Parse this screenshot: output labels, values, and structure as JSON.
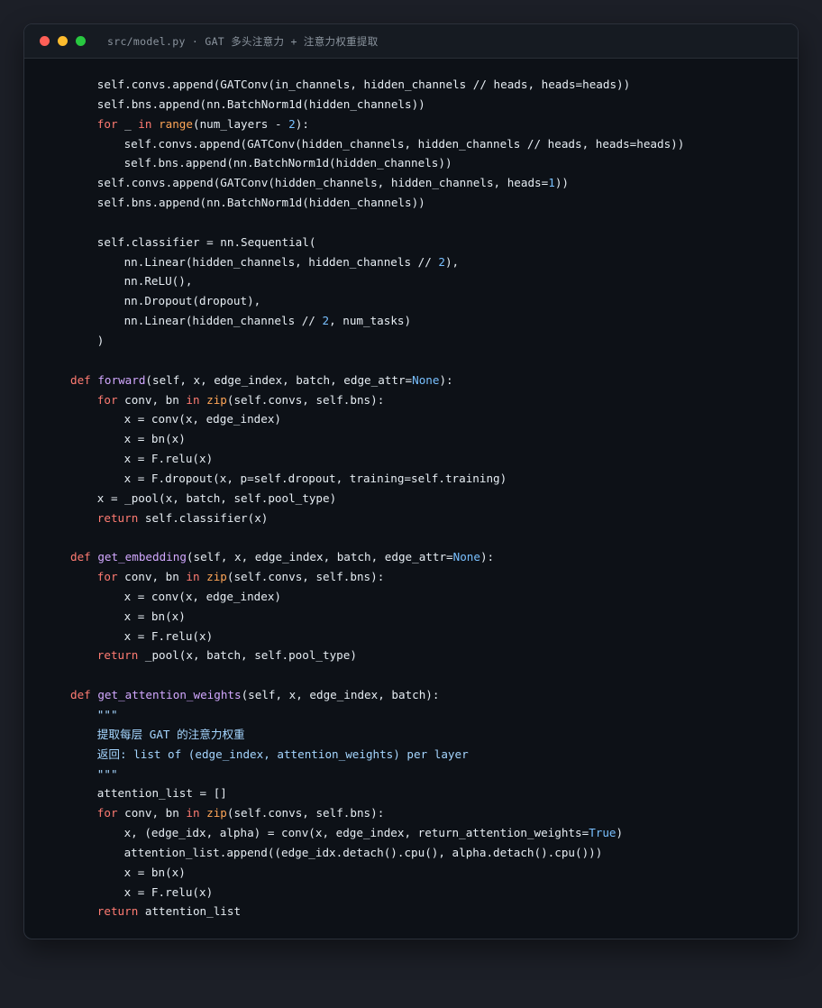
{
  "window": {
    "title": "src/model.py · GAT 多头注意力 + 注意力权重提取"
  },
  "colors": {
    "page_background": "#1c1f27",
    "editor_background": "#0d1117",
    "keyword": "#ff7b72",
    "function_name": "#d2a8ff",
    "builtin": "#ffa657",
    "number": "#79c0ff",
    "docstring": "#a5d6ff",
    "text": "#e6edf3"
  },
  "code_lines": [
    {
      "indent": 1,
      "tokens": [
        {
          "t": "self.convs.append(GATConv(in_channels, hidden_channels // heads, heads=heads))",
          "c": "plain"
        }
      ]
    },
    {
      "indent": 1,
      "tokens": [
        {
          "t": "self.bns.append(nn.BatchNorm1d(hidden_channels))",
          "c": "plain"
        }
      ]
    },
    {
      "indent": 1,
      "tokens": [
        {
          "t": "for",
          "c": "kw"
        },
        {
          "t": " _ ",
          "c": "plain"
        },
        {
          "t": "in",
          "c": "kw"
        },
        {
          "t": " ",
          "c": "plain"
        },
        {
          "t": "range",
          "c": "bi"
        },
        {
          "t": "(num_layers - ",
          "c": "plain"
        },
        {
          "t": "2",
          "c": "num"
        },
        {
          "t": "):",
          "c": "plain"
        }
      ]
    },
    {
      "indent": 2,
      "tokens": [
        {
          "t": "self.convs.append(GATConv(hidden_channels, hidden_channels // heads, heads=heads))",
          "c": "plain"
        }
      ]
    },
    {
      "indent": 2,
      "tokens": [
        {
          "t": "self.bns.append(nn.BatchNorm1d(hidden_channels))",
          "c": "plain"
        }
      ]
    },
    {
      "indent": 1,
      "tokens": [
        {
          "t": "self.convs.append(GATConv(hidden_channels, hidden_channels, heads=",
          "c": "plain"
        },
        {
          "t": "1",
          "c": "num"
        },
        {
          "t": "))",
          "c": "plain"
        }
      ]
    },
    {
      "indent": 1,
      "tokens": [
        {
          "t": "self.bns.append(nn.BatchNorm1d(hidden_channels))",
          "c": "plain"
        }
      ]
    },
    {
      "indent": 0,
      "tokens": []
    },
    {
      "indent": 1,
      "tokens": [
        {
          "t": "self.classifier = nn.Sequential(",
          "c": "plain"
        }
      ]
    },
    {
      "indent": 2,
      "tokens": [
        {
          "t": "nn.Linear(hidden_channels, hidden_channels // ",
          "c": "plain"
        },
        {
          "t": "2",
          "c": "num"
        },
        {
          "t": "),",
          "c": "plain"
        }
      ]
    },
    {
      "indent": 2,
      "tokens": [
        {
          "t": "nn.ReLU(),",
          "c": "plain"
        }
      ]
    },
    {
      "indent": 2,
      "tokens": [
        {
          "t": "nn.Dropout(dropout),",
          "c": "plain"
        }
      ]
    },
    {
      "indent": 2,
      "tokens": [
        {
          "t": "nn.Linear(hidden_channels // ",
          "c": "plain"
        },
        {
          "t": "2",
          "c": "num"
        },
        {
          "t": ", num_tasks)",
          "c": "plain"
        }
      ]
    },
    {
      "indent": 1,
      "tokens": [
        {
          "t": ")",
          "c": "plain"
        }
      ]
    },
    {
      "indent": 0,
      "tokens": []
    },
    {
      "indent": 0,
      "tokens": [
        {
          "t": "def",
          "c": "kw"
        },
        {
          "t": " ",
          "c": "plain"
        },
        {
          "t": "forward",
          "c": "fn"
        },
        {
          "t": "(self, x, edge_index, batch, edge_attr=",
          "c": "plain"
        },
        {
          "t": "None",
          "c": "const"
        },
        {
          "t": "):",
          "c": "plain"
        }
      ]
    },
    {
      "indent": 1,
      "tokens": [
        {
          "t": "for",
          "c": "kw"
        },
        {
          "t": " conv, bn ",
          "c": "plain"
        },
        {
          "t": "in",
          "c": "kw"
        },
        {
          "t": " ",
          "c": "plain"
        },
        {
          "t": "zip",
          "c": "bi"
        },
        {
          "t": "(self.convs, self.bns):",
          "c": "plain"
        }
      ]
    },
    {
      "indent": 2,
      "tokens": [
        {
          "t": "x = conv(x, edge_index)",
          "c": "plain"
        }
      ]
    },
    {
      "indent": 2,
      "tokens": [
        {
          "t": "x = bn(x)",
          "c": "plain"
        }
      ]
    },
    {
      "indent": 2,
      "tokens": [
        {
          "t": "x = F.relu(x)",
          "c": "plain"
        }
      ]
    },
    {
      "indent": 2,
      "tokens": [
        {
          "t": "x = F.dropout(x, p=self.dropout, training=self.training)",
          "c": "plain"
        }
      ]
    },
    {
      "indent": 1,
      "tokens": [
        {
          "t": "x = _pool(x, batch, self.pool_type)",
          "c": "plain"
        }
      ]
    },
    {
      "indent": 1,
      "tokens": [
        {
          "t": "return",
          "c": "kw"
        },
        {
          "t": " self.classifier(x)",
          "c": "plain"
        }
      ]
    },
    {
      "indent": 0,
      "tokens": []
    },
    {
      "indent": 0,
      "tokens": [
        {
          "t": "def",
          "c": "kw"
        },
        {
          "t": " ",
          "c": "plain"
        },
        {
          "t": "get_embedding",
          "c": "fn"
        },
        {
          "t": "(self, x, edge_index, batch, edge_attr=",
          "c": "plain"
        },
        {
          "t": "None",
          "c": "const"
        },
        {
          "t": "):",
          "c": "plain"
        }
      ]
    },
    {
      "indent": 1,
      "tokens": [
        {
          "t": "for",
          "c": "kw"
        },
        {
          "t": " conv, bn ",
          "c": "plain"
        },
        {
          "t": "in",
          "c": "kw"
        },
        {
          "t": " ",
          "c": "plain"
        },
        {
          "t": "zip",
          "c": "bi"
        },
        {
          "t": "(self.convs, self.bns):",
          "c": "plain"
        }
      ]
    },
    {
      "indent": 2,
      "tokens": [
        {
          "t": "x = conv(x, edge_index)",
          "c": "plain"
        }
      ]
    },
    {
      "indent": 2,
      "tokens": [
        {
          "t": "x = bn(x)",
          "c": "plain"
        }
      ]
    },
    {
      "indent": 2,
      "tokens": [
        {
          "t": "x = F.relu(x)",
          "c": "plain"
        }
      ]
    },
    {
      "indent": 1,
      "tokens": [
        {
          "t": "return",
          "c": "kw"
        },
        {
          "t": " _pool(x, batch, self.pool_type)",
          "c": "plain"
        }
      ]
    },
    {
      "indent": 0,
      "tokens": []
    },
    {
      "indent": 0,
      "tokens": [
        {
          "t": "def",
          "c": "kw"
        },
        {
          "t": " ",
          "c": "plain"
        },
        {
          "t": "get_attention_weights",
          "c": "fn"
        },
        {
          "t": "(self, x, edge_index, batch):",
          "c": "plain"
        }
      ]
    },
    {
      "indent": 1,
      "tokens": [
        {
          "t": "\"\"\"",
          "c": "doc"
        }
      ]
    },
    {
      "indent": 1,
      "tokens": [
        {
          "t": "提取每层 GAT 的注意力权重",
          "c": "doc"
        }
      ]
    },
    {
      "indent": 1,
      "tokens": [
        {
          "t": "返回: list of (edge_index, attention_weights) per layer",
          "c": "doc"
        }
      ]
    },
    {
      "indent": 1,
      "tokens": [
        {
          "t": "\"\"\"",
          "c": "doc"
        }
      ]
    },
    {
      "indent": 1,
      "tokens": [
        {
          "t": "attention_list = []",
          "c": "plain"
        }
      ]
    },
    {
      "indent": 1,
      "tokens": [
        {
          "t": "for",
          "c": "kw"
        },
        {
          "t": " conv, bn ",
          "c": "plain"
        },
        {
          "t": "in",
          "c": "kw"
        },
        {
          "t": " ",
          "c": "plain"
        },
        {
          "t": "zip",
          "c": "bi"
        },
        {
          "t": "(self.convs, self.bns):",
          "c": "plain"
        }
      ]
    },
    {
      "indent": 2,
      "tokens": [
        {
          "t": "x, (edge_idx, alpha) = conv(x, edge_index, return_attention_weights=",
          "c": "plain"
        },
        {
          "t": "True",
          "c": "const"
        },
        {
          "t": ")",
          "c": "plain"
        }
      ]
    },
    {
      "indent": 2,
      "tokens": [
        {
          "t": "attention_list.append((edge_idx.detach().cpu(), alpha.detach().cpu()))",
          "c": "plain"
        }
      ]
    },
    {
      "indent": 2,
      "tokens": [
        {
          "t": "x = bn(x)",
          "c": "plain"
        }
      ]
    },
    {
      "indent": 2,
      "tokens": [
        {
          "t": "x = F.relu(x)",
          "c": "plain"
        }
      ]
    },
    {
      "indent": 1,
      "tokens": [
        {
          "t": "return",
          "c": "kw"
        },
        {
          "t": " attention_list",
          "c": "plain"
        }
      ]
    }
  ]
}
